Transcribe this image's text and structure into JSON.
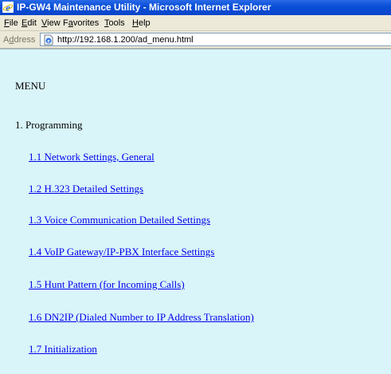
{
  "window": {
    "title": "IP-GW4 Maintenance Utility - Microsoft Internet Explorer"
  },
  "menubar": {
    "items": [
      {
        "acc": "F",
        "rest": "ile"
      },
      {
        "acc": "E",
        "rest": "dit"
      },
      {
        "acc": "V",
        "rest": "iew"
      },
      {
        "pre": "F",
        "acc": "a",
        "rest": "vorites"
      },
      {
        "acc": "T",
        "rest": "ools"
      },
      {
        "acc": "H",
        "rest": "elp"
      }
    ]
  },
  "addressbar": {
    "label_pre": "A",
    "label_acc": "d",
    "label_rest": "dress",
    "url": "http://192.168.1.200/ad_menu.html"
  },
  "page": {
    "heading": "MENU",
    "section": "1. Programming",
    "links": [
      "1.1 Network Settings, General",
      "1.2 H.323 Detailed Settings",
      "1.3 Voice Communication Detailed Settings",
      "1.4 VoIP Gateway/IP-PBX Interface Settings",
      "1.5 Hunt Pattern (for Incoming Calls)",
      "1.6 DN2IP (Dialed Number to IP Address Translation)",
      "1.7 Initialization"
    ]
  },
  "colors": {
    "titlebar": "#0a4fd8",
    "content_background": "#d9f5f9",
    "link": "#0000ee"
  },
  "icons": {
    "window_icon": "internet-explorer-icon",
    "address_icon": "web-page-icon"
  }
}
